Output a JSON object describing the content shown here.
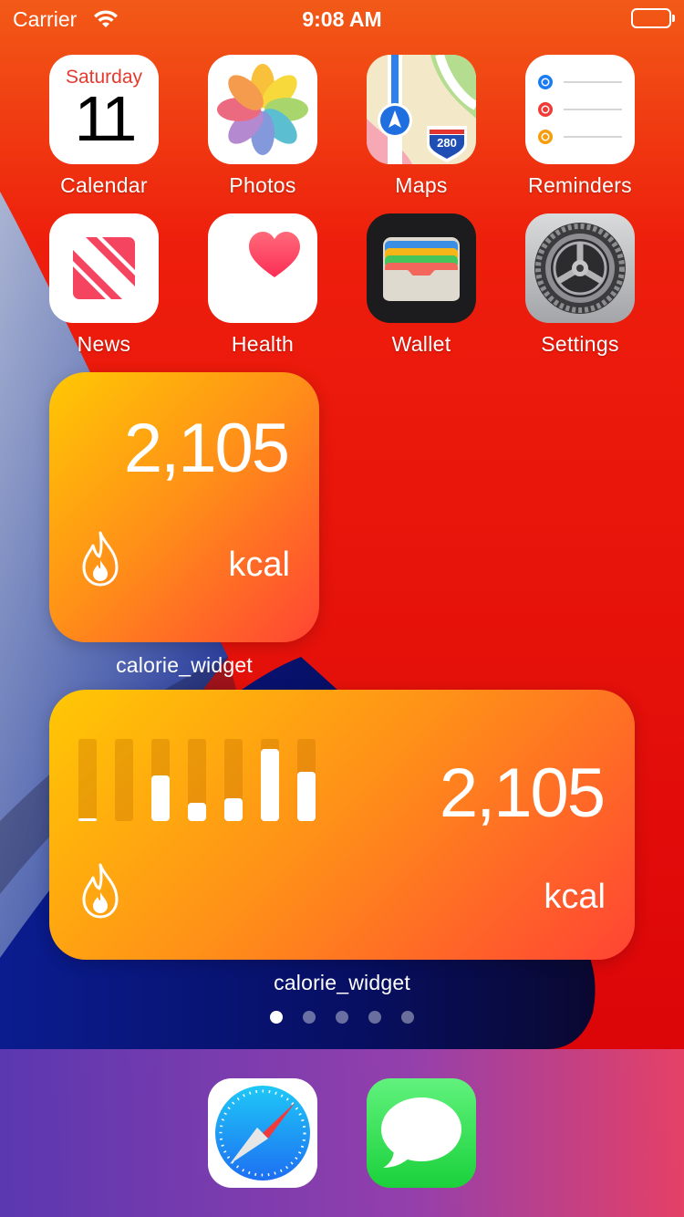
{
  "status_bar": {
    "carrier": "Carrier",
    "time": "9:08 AM"
  },
  "home_screen": {
    "apps": [
      {
        "label": "Calendar",
        "icon": "calendar-icon",
        "weekday": "Saturday",
        "date": "11"
      },
      {
        "label": "Photos",
        "icon": "photos-icon"
      },
      {
        "label": "Maps",
        "icon": "maps-icon",
        "badge_text": "280"
      },
      {
        "label": "Reminders",
        "icon": "reminders-icon"
      },
      {
        "label": "News",
        "icon": "news-icon"
      },
      {
        "label": "Health",
        "icon": "health-icon"
      },
      {
        "label": "Wallet",
        "icon": "wallet-icon"
      },
      {
        "label": "Settings",
        "icon": "settings-icon"
      }
    ],
    "widgets": [
      {
        "size": "small",
        "value": "2,105",
        "unit": "kcal",
        "caption": "calorie_widget",
        "icon": "flame-icon"
      },
      {
        "size": "medium",
        "value": "2,105",
        "unit": "kcal",
        "caption": "calorie_widget",
        "icon": "flame-icon",
        "bar_levels": [
          0.02,
          0,
          0.56,
          0.22,
          0.28,
          0.88,
          0.6
        ]
      }
    ],
    "page_indicator": {
      "total": 5,
      "current": 1
    }
  },
  "dock": {
    "apps": [
      {
        "label": "Safari",
        "icon": "safari-compass-icon"
      },
      {
        "label": "Messages",
        "icon": "message-bubble-icon"
      }
    ]
  },
  "colors": {
    "wallpaper_red": "#e8080a",
    "widget_gradient_start": "#ffc804",
    "widget_gradient_end": "#ff4434",
    "calendar_red": "#e53a2f"
  }
}
